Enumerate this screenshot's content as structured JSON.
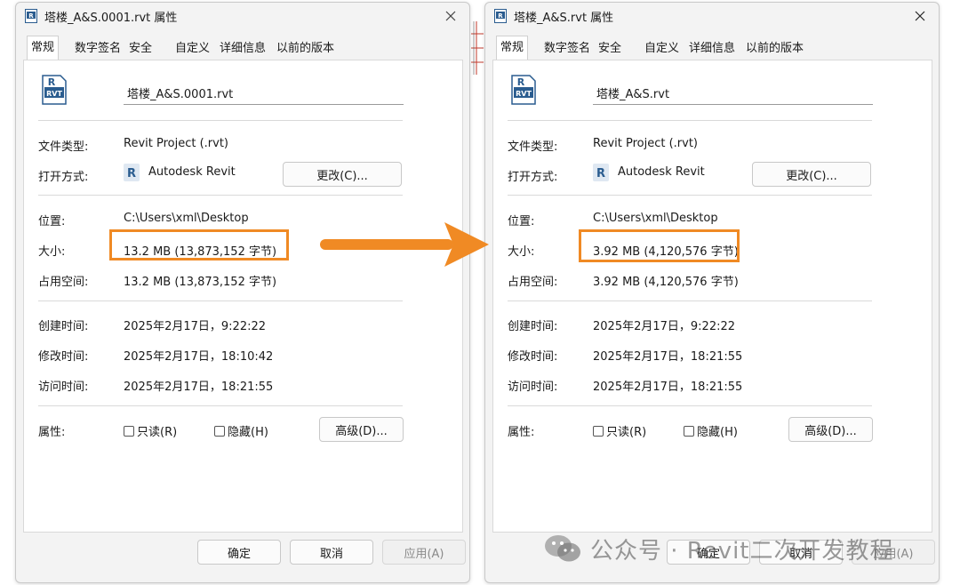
{
  "left_dialog": {
    "title": "塔楼_A&S.0001.rvt 属性",
    "tabs": [
      "常规",
      "数字签名",
      "安全",
      "自定义",
      "详细信息",
      "以前的版本"
    ],
    "file_name": "塔楼_A&S.0001.rvt",
    "file_type_label": "文件类型:",
    "file_type_value": "Revit Project (.rvt)",
    "open_with_label": "打开方式:",
    "open_with_value": "Autodesk Revit",
    "change_button": "更改(C)...",
    "location_label": "位置:",
    "location_value": "C:\\Users\\xml\\Desktop",
    "size_label": "大小:",
    "size_value": "13.2 MB (13,873,152 字节)",
    "disk_size_label": "占用空间:",
    "disk_size_value": "13.2 MB (13,873,152 字节)",
    "created_label": "创建时间:",
    "created_value": "2025年2月17日，9:22:22",
    "modified_label": "修改时间:",
    "modified_value": "2025年2月17日，18:10:42",
    "accessed_label": "访问时间:",
    "accessed_value": "2025年2月17日，18:21:55",
    "attributes_label": "属性:",
    "readonly_label": "只读(R)",
    "hidden_label": "隐藏(H)",
    "advanced_button": "高级(D)...",
    "ok_button": "确定",
    "cancel_button": "取消",
    "apply_button": "应用(A)"
  },
  "right_dialog": {
    "title": "塔楼_A&S.rvt 属性",
    "tabs": [
      "常规",
      "数字签名",
      "安全",
      "自定义",
      "详细信息",
      "以前的版本"
    ],
    "file_name": "塔楼_A&S.rvt",
    "file_type_label": "文件类型:",
    "file_type_value": "Revit Project (.rvt)",
    "open_with_label": "打开方式:",
    "open_with_value": "Autodesk Revit",
    "change_button": "更改(C)...",
    "location_label": "位置:",
    "location_value": "C:\\Users\\xml\\Desktop",
    "size_label": "大小:",
    "size_value": "3.92 MB (4,120,576 字节)",
    "disk_size_label": "占用空间:",
    "disk_size_value": "3.92 MB (4,120,576 字节)",
    "created_label": "创建时间:",
    "created_value": "2025年2月17日，9:22:22",
    "modified_label": "修改时间:",
    "modified_value": "2025年2月17日，18:21:55",
    "accessed_label": "访问时间:",
    "accessed_value": "2025年2月17日，18:21:55",
    "attributes_label": "属性:",
    "readonly_label": "只读(R)",
    "hidden_label": "隐藏(H)",
    "advanced_button": "高级(D)...",
    "ok_button": "确定",
    "cancel_button": "取消",
    "apply_button": "应用(A)"
  },
  "watermark": {
    "text": "公众号 · Revit二次开发教程"
  },
  "colors": {
    "highlight": "#f08a24",
    "arrow": "#f08a24",
    "revit_blue": "#2a5c8f"
  }
}
